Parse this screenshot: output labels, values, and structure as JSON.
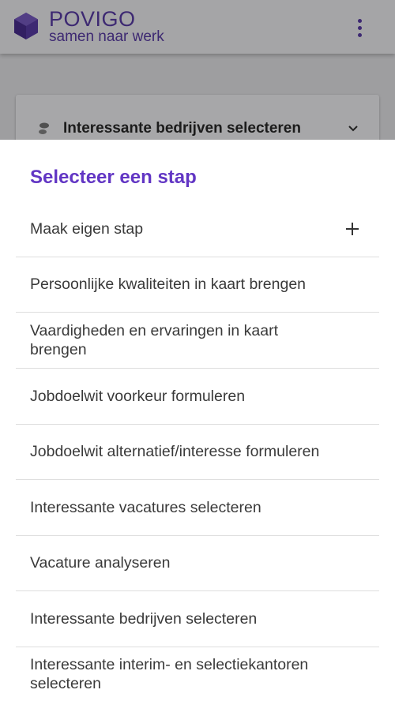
{
  "header": {
    "brand_title": "POVIGO",
    "brand_subtitle": "samen naar werk",
    "logo_icon": "hexagon-cube-icon",
    "menu_icon": "more-vert-icon"
  },
  "background_card": {
    "label": "Interessante bedrijven selecteren",
    "icon": "footsteps-icon",
    "chevron": "chevron-down-icon"
  },
  "sheet": {
    "title": "Selecteer een stap",
    "custom_step": {
      "label": "Maak eigen stap",
      "icon": "plus-icon"
    },
    "steps": [
      {
        "label": "Persoonlijke kwaliteiten in kaart brengen"
      },
      {
        "label": "Vaardigheden en ervaringen in kaart brengen"
      },
      {
        "label": "Jobdoelwit voorkeur formuleren"
      },
      {
        "label": "Jobdoelwit alternatief/interesse formuleren"
      },
      {
        "label": "Interessante vacatures selecteren"
      },
      {
        "label": "Vacature analyseren"
      },
      {
        "label": "Interessante bedrijven selecteren"
      },
      {
        "label": "Interessante interim- en selectiekantoren selecteren"
      }
    ]
  },
  "colors": {
    "brand": "#5b3da8",
    "accent": "#6236c4",
    "text": "#3a3a3a",
    "divider": "#dedede"
  }
}
